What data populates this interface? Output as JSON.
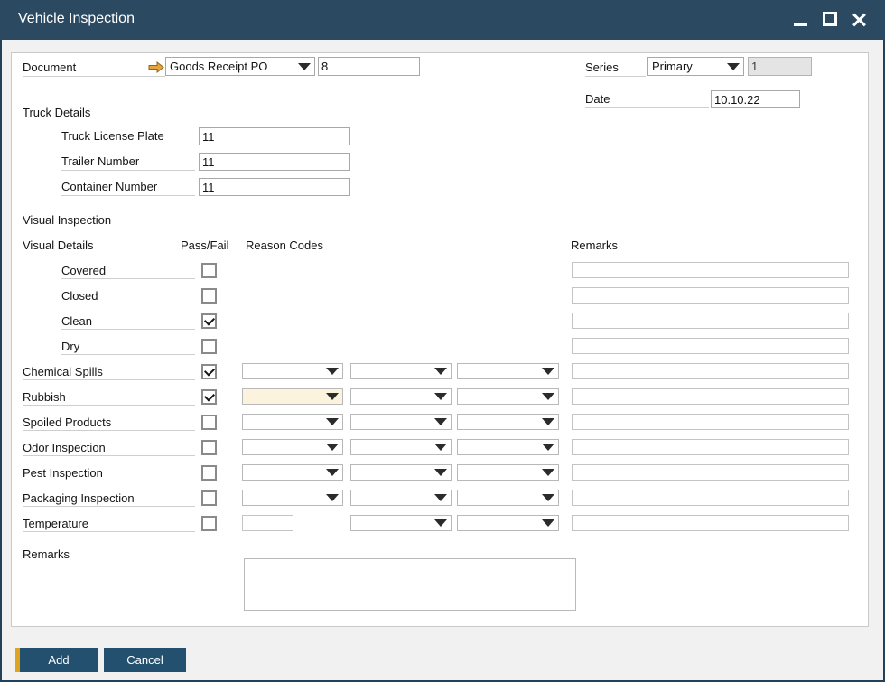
{
  "window": {
    "title": "Vehicle Inspection"
  },
  "header": {
    "document_label": "Document",
    "document_type": "Goods Receipt PO",
    "document_number": "8",
    "series_label": "Series",
    "series_value": "Primary",
    "series_number": "1",
    "date_label": "Date",
    "date_value": "10.10.22"
  },
  "truck_details": {
    "section_label": "Truck Details",
    "fields": [
      {
        "label": "Truck License Plate",
        "value": "11"
      },
      {
        "label": "Trailer Number",
        "value": "11"
      },
      {
        "label": "Container Number",
        "value": "11"
      }
    ]
  },
  "visual_inspection": {
    "section_label": "Visual Inspection",
    "columns": {
      "details": "Visual Details",
      "pass_fail": "Pass/Fail",
      "reason_codes": "Reason Codes",
      "remarks": "Remarks"
    },
    "rows": [
      {
        "label": "Covered",
        "checked": false,
        "remarks": ""
      },
      {
        "label": "Closed",
        "checked": false,
        "remarks": ""
      },
      {
        "label": "Clean",
        "checked": true,
        "remarks": ""
      },
      {
        "label": "Dry",
        "checked": false,
        "remarks": ""
      },
      {
        "label": "Chemical Spills",
        "checked": true,
        "reason_codes": [
          "",
          "",
          ""
        ],
        "remarks": ""
      },
      {
        "label": "Rubbish",
        "checked": true,
        "reason_codes": [
          "",
          "",
          ""
        ],
        "remarks": "",
        "focused": true
      },
      {
        "label": "Spoiled Products",
        "checked": false,
        "reason_codes": [
          "",
          "",
          ""
        ],
        "remarks": ""
      },
      {
        "label": "Odor Inspection",
        "checked": false,
        "reason_codes": [
          "",
          "",
          ""
        ],
        "remarks": ""
      },
      {
        "label": "Pest Inspection",
        "checked": false,
        "reason_codes": [
          "",
          "",
          ""
        ],
        "remarks": ""
      },
      {
        "label": "Packaging Inspection",
        "checked": false,
        "reason_codes": [
          "",
          "",
          ""
        ],
        "remarks": ""
      },
      {
        "label": "Temperature",
        "checked": false,
        "temperature_value": "",
        "reason_codes": [
          "",
          ""
        ],
        "remarks": ""
      }
    ]
  },
  "footer": {
    "remarks_label": "Remarks",
    "remarks_value": ""
  },
  "actions": {
    "add_label": "Add",
    "cancel_label": "Cancel"
  },
  "colors": {
    "titlebar": "#2b4a62",
    "window_border": "#24415a",
    "button": "#23506f",
    "button_accent": "#dfa41f",
    "focused_field": "#fcf3de",
    "link_arrow": "#e8a33d"
  }
}
